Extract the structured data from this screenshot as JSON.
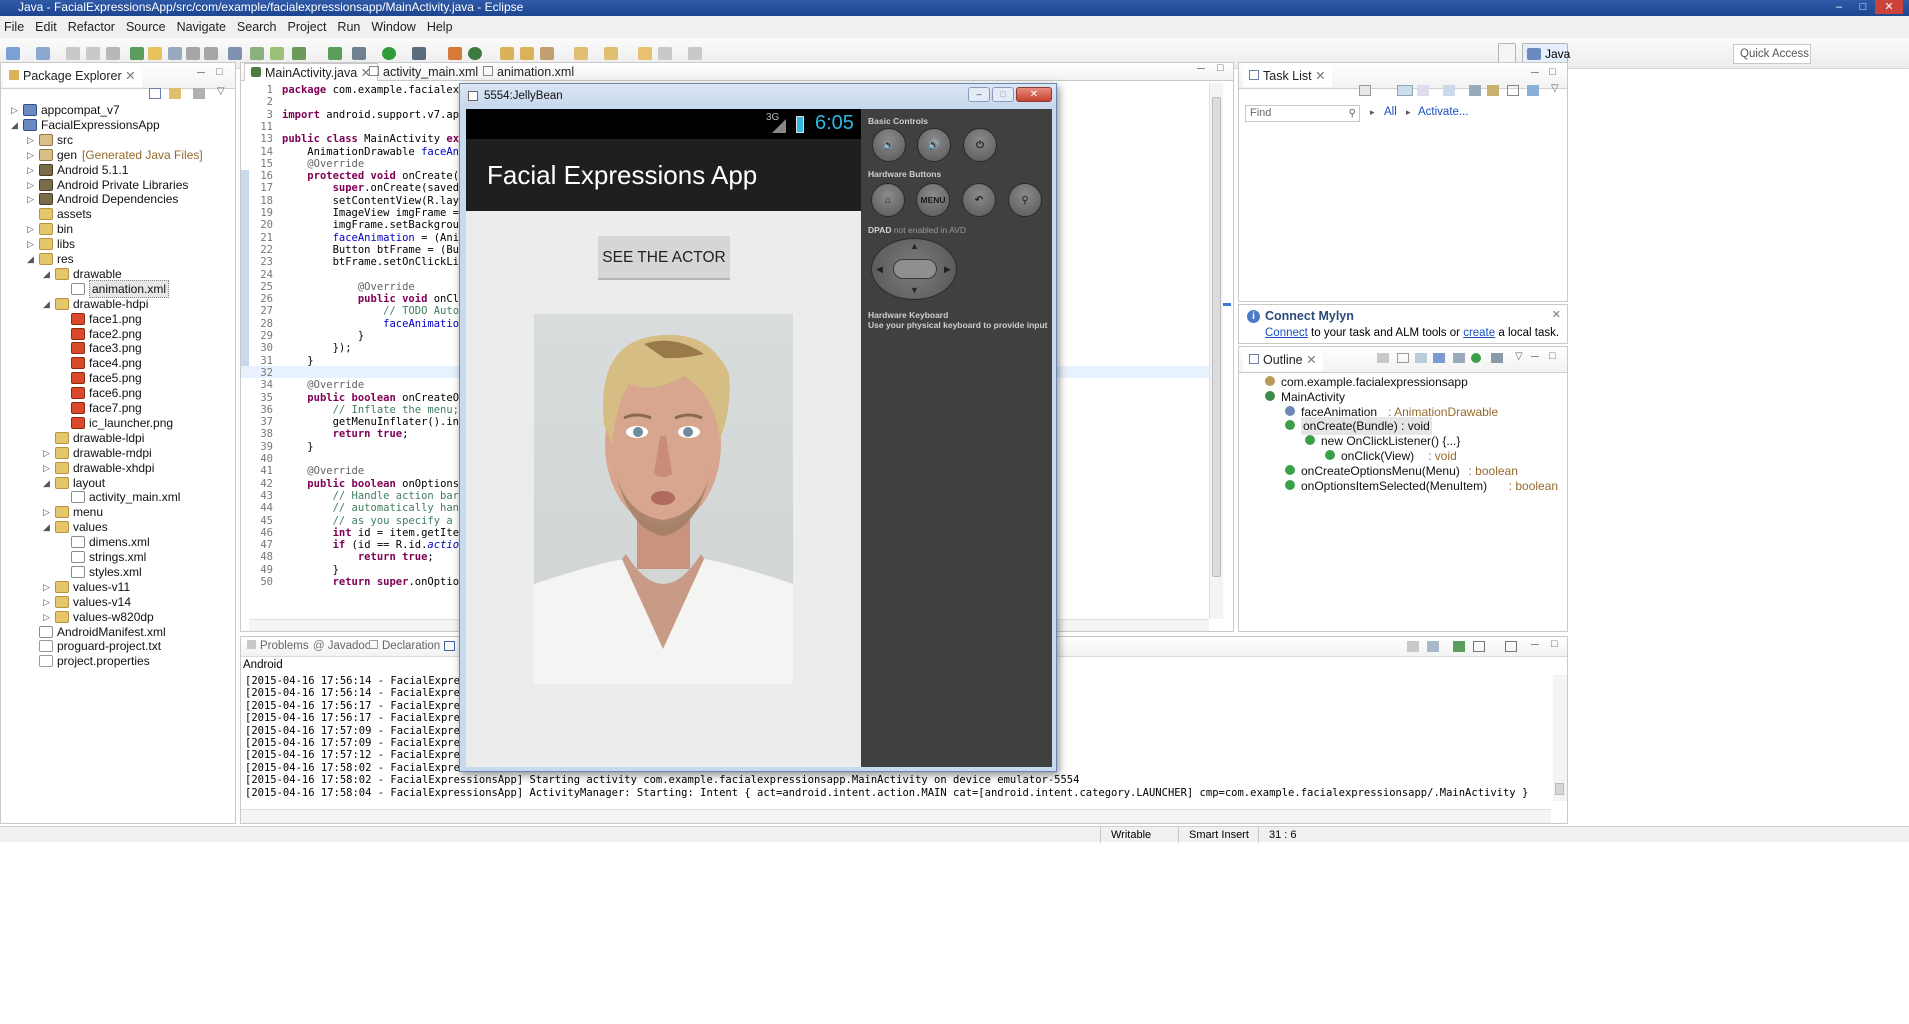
{
  "window": {
    "title": "Java - FacialExpressionsApp/src/com/example/facialexpressionsapp/MainActivity.java - Eclipse"
  },
  "menu": [
    "File",
    "Edit",
    "Refactor",
    "Source",
    "Navigate",
    "Search",
    "Project",
    "Run",
    "Window",
    "Help"
  ],
  "toolbar": {
    "quick_access": "Quick Access",
    "perspective": "Java"
  },
  "package_explorer": {
    "title": "Package Explorer",
    "items": [
      {
        "label": "appcompat_v7",
        "depth": 0,
        "icon": "proj",
        "tw": "▷"
      },
      {
        "label": "FacialExpressionsApp",
        "depth": 0,
        "icon": "proj",
        "tw": "◢"
      },
      {
        "label": "src",
        "depth": 1,
        "icon": "pkg",
        "tw": "▷"
      },
      {
        "label": "gen",
        "extra": "[Generated Java Files]",
        "depth": 1,
        "icon": "pkg",
        "tw": "▷"
      },
      {
        "label": "Android 5.1.1",
        "depth": 1,
        "icon": "lib",
        "tw": "▷"
      },
      {
        "label": "Android Private Libraries",
        "depth": 1,
        "icon": "lib",
        "tw": "▷"
      },
      {
        "label": "Android Dependencies",
        "depth": 1,
        "icon": "lib",
        "tw": "▷"
      },
      {
        "label": "assets",
        "depth": 1,
        "icon": "folder",
        "tw": ""
      },
      {
        "label": "bin",
        "depth": 1,
        "icon": "folder",
        "tw": "▷"
      },
      {
        "label": "libs",
        "depth": 1,
        "icon": "folder",
        "tw": "▷"
      },
      {
        "label": "res",
        "depth": 1,
        "icon": "folder",
        "tw": "◢"
      },
      {
        "label": "drawable",
        "depth": 2,
        "icon": "folder",
        "tw": "◢"
      },
      {
        "label": "animation.xml",
        "depth": 3,
        "icon": "xml",
        "tw": "",
        "selected": true
      },
      {
        "label": "drawable-hdpi",
        "depth": 2,
        "icon": "folder",
        "tw": "◢"
      },
      {
        "label": "face1.png",
        "depth": 3,
        "icon": "img",
        "tw": ""
      },
      {
        "label": "face2.png",
        "depth": 3,
        "icon": "img",
        "tw": ""
      },
      {
        "label": "face3.png",
        "depth": 3,
        "icon": "img",
        "tw": ""
      },
      {
        "label": "face4.png",
        "depth": 3,
        "icon": "img",
        "tw": ""
      },
      {
        "label": "face5.png",
        "depth": 3,
        "icon": "img",
        "tw": ""
      },
      {
        "label": "face6.png",
        "depth": 3,
        "icon": "img",
        "tw": ""
      },
      {
        "label": "face7.png",
        "depth": 3,
        "icon": "img",
        "tw": ""
      },
      {
        "label": "ic_launcher.png",
        "depth": 3,
        "icon": "img",
        "tw": ""
      },
      {
        "label": "drawable-ldpi",
        "depth": 2,
        "icon": "folder",
        "tw": ""
      },
      {
        "label": "drawable-mdpi",
        "depth": 2,
        "icon": "folder",
        "tw": "▷"
      },
      {
        "label": "drawable-xhdpi",
        "depth": 2,
        "icon": "folder",
        "tw": "▷"
      },
      {
        "label": "layout",
        "depth": 2,
        "icon": "folder",
        "tw": "◢"
      },
      {
        "label": "activity_main.xml",
        "depth": 3,
        "icon": "xml",
        "tw": ""
      },
      {
        "label": "menu",
        "depth": 2,
        "icon": "folder",
        "tw": "▷"
      },
      {
        "label": "values",
        "depth": 2,
        "icon": "folder",
        "tw": "◢"
      },
      {
        "label": "dimens.xml",
        "depth": 3,
        "icon": "xml",
        "tw": ""
      },
      {
        "label": "strings.xml",
        "depth": 3,
        "icon": "xml",
        "tw": ""
      },
      {
        "label": "styles.xml",
        "depth": 3,
        "icon": "xml",
        "tw": ""
      },
      {
        "label": "values-v11",
        "depth": 2,
        "icon": "folder",
        "tw": "▷"
      },
      {
        "label": "values-v14",
        "depth": 2,
        "icon": "folder",
        "tw": "▷"
      },
      {
        "label": "values-w820dp",
        "depth": 2,
        "icon": "folder",
        "tw": "▷"
      },
      {
        "label": "AndroidManifest.xml",
        "depth": 1,
        "icon": "xml",
        "tw": ""
      },
      {
        "label": "proguard-project.txt",
        "depth": 1,
        "icon": "txt",
        "tw": ""
      },
      {
        "label": "project.properties",
        "depth": 1,
        "icon": "txt",
        "tw": ""
      }
    ]
  },
  "editor": {
    "tabs": [
      "MainActivity.java",
      "activity_main.xml",
      "animation.xml"
    ],
    "lines": [
      {
        "n": "1",
        "html": "<span class=\"kw\">package</span> com.example.facialexpres"
      },
      {
        "n": "2",
        "html": ""
      },
      {
        "n": "3",
        "html": "<span class=\"kw\">import</span> android.support.v7.app.Ac"
      },
      {
        "n": "11",
        "html": ""
      },
      {
        "n": "13",
        "html": "<span class=\"kw\">public class</span> MainActivity <span class=\"kw\">extend</span>"
      },
      {
        "n": "14",
        "html": "    AnimationDrawable <span class=\"fld\">faceAnimat</span>"
      },
      {
        "n": "15",
        "html": "    <span class=\"ann\">@Override</span>"
      },
      {
        "n": "16",
        "html": "    <span class=\"kw\">protected void</span> onCreate(Bund"
      },
      {
        "n": "17",
        "html": "        <span class=\"kw\">super</span>.onCreate(savedInst"
      },
      {
        "n": "18",
        "html": "        setContentView(R.layout."
      },
      {
        "n": "19",
        "html": "        ImageView imgFrame = (Im"
      },
      {
        "n": "20",
        "html": "        imgFrame.setBackgroundRe"
      },
      {
        "n": "21",
        "html": "        <span class=\"fld\">faceAnimation</span> = (Animati"
      },
      {
        "n": "22",
        "html": "        Button btFrame = (Button"
      },
      {
        "n": "23",
        "html": "        btFrame.setOnClickListen"
      },
      {
        "n": "24",
        "html": ""
      },
      {
        "n": "25",
        "html": "            <span class=\"ann\">@Override</span>"
      },
      {
        "n": "26",
        "html": "            <span class=\"kw\">public void</span> onClick("
      },
      {
        "n": "27",
        "html": "                <span class=\"cmt\">// TODO Auto-gen</span>"
      },
      {
        "n": "28",
        "html": "                <span class=\"fld\">faceAnimation</span>.st"
      },
      {
        "n": "29",
        "html": "            }"
      },
      {
        "n": "30",
        "html": "        });"
      },
      {
        "n": "31",
        "html": "    }"
      },
      {
        "n": "32",
        "html": ""
      },
      {
        "n": "34",
        "html": "    <span class=\"ann\">@Override</span>"
      },
      {
        "n": "35",
        "html": "    <span class=\"kw\">public boolean</span> onCreateOptio"
      },
      {
        "n": "36",
        "html": "        <span class=\"cmt\">// Inflate the menu; thi</span>"
      },
      {
        "n": "37",
        "html": "        getMenuInflater().inflat"
      },
      {
        "n": "38",
        "html": "        <span class=\"kw\">return true</span>;"
      },
      {
        "n": "39",
        "html": "    }"
      },
      {
        "n": "40",
        "html": ""
      },
      {
        "n": "41",
        "html": "    <span class=\"ann\">@Override</span>"
      },
      {
        "n": "42",
        "html": "    <span class=\"kw\">public boolean</span> onOptionsItem"
      },
      {
        "n": "43",
        "html": "        <span class=\"cmt\">// Handle action bar ite</span>"
      },
      {
        "n": "44",
        "html": "        <span class=\"cmt\">// automatically handle </span>"
      },
      {
        "n": "45",
        "html": "        <span class=\"cmt\">// as you specify a pare</span>"
      },
      {
        "n": "46",
        "html": "        <span class=\"kw\">int</span> id = item.getItemId("
      },
      {
        "n": "47",
        "html": "        <span class=\"kw\">if</span> (id == R.id.<span class=\"fld\"><i>action_se</i></span>"
      },
      {
        "n": "48",
        "html": "            <span class=\"kw\">return true</span>;"
      },
      {
        "n": "49",
        "html": "        }"
      },
      {
        "n": "50",
        "html": "        <span class=\"kw\">return super</span>.onOptionsIt"
      }
    ]
  },
  "task_list": {
    "title": "Task List",
    "find_placeholder": "Find",
    "all": "All",
    "activate": "Activate..."
  },
  "mylyn": {
    "title": "Connect Mylyn",
    "connect": "Connect",
    "text1": " to your task and ALM tools or ",
    "create": "create",
    "text2": " a local task."
  },
  "outline": {
    "title": "Outline",
    "items": [
      {
        "label": "com.example.facialexpressionsapp",
        "type": "",
        "depth": 0
      },
      {
        "label": "MainActivity",
        "type": "",
        "depth": 0
      },
      {
        "label": "faceAnimation",
        "type": " : AnimationDrawable",
        "depth": 1
      },
      {
        "label": "onCreate(Bundle) : void",
        "type": "",
        "depth": 1,
        "selected": true
      },
      {
        "label": "new OnClickListener() {...}",
        "type": "",
        "depth": 2
      },
      {
        "label": "onClick(View)",
        "type": " : void",
        "depth": 3
      },
      {
        "label": "onCreateOptionsMenu(Menu)",
        "type": " : boolean",
        "depth": 1
      },
      {
        "label": "onOptionsItemSelected(MenuItem)",
        "type": " : boolean",
        "depth": 1
      }
    ]
  },
  "bottom": {
    "tabs": [
      "Problems",
      "Javadoc",
      "Declaration"
    ],
    "console_label": "Android",
    "lines": [
      "[2015-04-16 17:56:14 - FacialExpressi",
      "[2015-04-16 17:56:14 - FacialExpressi",
      "[2015-04-16 17:56:17 - FacialExpressi",
      "[2015-04-16 17:56:17 - FacialExpressi",
      "[2015-04-16 17:57:09 - FacialExpressi",
      "[2015-04-16 17:57:09 - FacialExpressi",
      "[2015-04-16 17:57:12 - FacialExpressi",
      "[2015-04-16 17:58:02 - FacialExpressi",
      "[2015-04-16 17:58:02 - FacialExpressionsApp] Starting activity com.example.facialexpressionsapp.MainActivity on device emulator-5554",
      "[2015-04-16 17:58:04 - FacialExpressionsApp] ActivityManager: Starting: Intent { act=android.intent.action.MAIN cat=[android.intent.category.LAUNCHER] cmp=com.example.facialexpressionsapp/.MainActivity }"
    ]
  },
  "status": {
    "writable": "Writable",
    "insert": "Smart Insert",
    "pos": "31 : 6"
  },
  "emulator": {
    "title": "5554:JellyBean",
    "network": "3G",
    "clock": "6:05",
    "app_title": "Facial Expressions App",
    "button": "SEE THE ACTOR",
    "basic_controls": "Basic Controls",
    "hardware_buttons": "Hardware Buttons",
    "menu_btn": "MENU",
    "dpad": "DPAD",
    "dpad_note": " not enabled in AVD",
    "hw_keyboard": "Hardware Keyboard",
    "hw_keyboard_note": "Use your physical keyboard to provide input"
  }
}
